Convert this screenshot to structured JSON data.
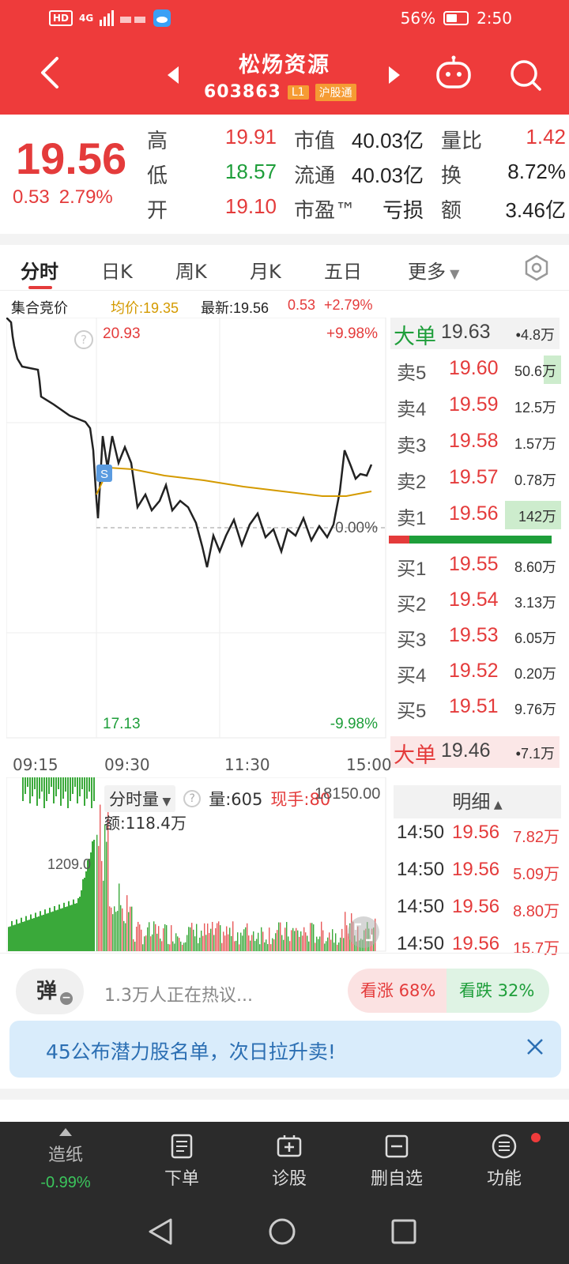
{
  "status_bar": {
    "network": "HD",
    "signal": "4G",
    "battery_pct": "56%",
    "time": "2:50"
  },
  "header": {
    "stock_name": "松炀资源",
    "stock_code": "603863",
    "tag_level": "L1",
    "tag_connect": "沪股通"
  },
  "quote": {
    "price": "19.56",
    "change": "0.53",
    "change_pct": "2.79%",
    "high_label": "高",
    "high": "19.91",
    "low_label": "低",
    "low": "18.57",
    "open_label": "开",
    "open": "19.10",
    "mcap_label": "市值",
    "mcap": "40.03亿",
    "float_label": "流通",
    "float": "40.03亿",
    "pe_label": "市盈™",
    "pe": "亏损",
    "vr_label": "量比",
    "vr": "1.42",
    "turn_label": "换",
    "turn": "8.72%",
    "amt_label": "额",
    "amt": "3.46亿"
  },
  "tabs": [
    "分时",
    "日K",
    "周K",
    "月K",
    "五日",
    "更多"
  ],
  "info_row": {
    "auction": "集合竞价",
    "avg": "均价:19.35",
    "latest": "最新:19.56",
    "chg": "0.53",
    "pct": "+2.79%"
  },
  "chart_labels": {
    "top_price": "20.93",
    "top_pct": "+9.98%",
    "bottom_price": "17.13",
    "bottom_pct": "-9.98%",
    "zero_pct": "0.00%",
    "s_marker": "S"
  },
  "time_axis": [
    "09:15",
    "09:30",
    "11:30",
    "15:00"
  ],
  "order_book": {
    "big_top": {
      "label": "大单",
      "price": "19.63",
      "vol": "•4.8万"
    },
    "asks": [
      {
        "label": "卖5",
        "price": "19.60",
        "vol": "50.6万",
        "fill": 0.1
      },
      {
        "label": "卖4",
        "price": "19.59",
        "vol": "12.5万",
        "fill": 0
      },
      {
        "label": "卖3",
        "price": "19.58",
        "vol": "1.57万",
        "fill": 0
      },
      {
        "label": "卖2",
        "price": "19.57",
        "vol": "0.78万",
        "fill": 0
      },
      {
        "label": "卖1",
        "price": "19.56",
        "vol": "142万",
        "fill": 0.32
      }
    ],
    "bids": [
      {
        "label": "买1",
        "price": "19.55",
        "vol": "8.60万"
      },
      {
        "label": "买2",
        "price": "19.54",
        "vol": "3.13万"
      },
      {
        "label": "买3",
        "price": "19.53",
        "vol": "6.05万"
      },
      {
        "label": "买4",
        "price": "19.52",
        "vol": "0.20万"
      },
      {
        "label": "买5",
        "price": "19.51",
        "vol": "9.76万"
      }
    ],
    "big_bottom": {
      "label": "大单",
      "price": "19.46",
      "vol": "•7.1万"
    }
  },
  "volume": {
    "title": "分时量",
    "vol": "量:605",
    "hand": "现手:80",
    "max": "18150.00",
    "amount": "额:118.4万",
    "mid": "1209.0"
  },
  "detail": {
    "title": "明细",
    "rows": [
      {
        "time": "14:50",
        "price": "19.56",
        "vol": "7.82万"
      },
      {
        "time": "14:50",
        "price": "19.56",
        "vol": "5.09万"
      },
      {
        "time": "14:50",
        "price": "19.56",
        "vol": "8.80万"
      },
      {
        "time": "14:50",
        "price": "19.56",
        "vol": "15.7万"
      }
    ]
  },
  "comment": {
    "dan": "弹",
    "discuss": "1.3万人正在热议...",
    "bull": "看涨 68%",
    "bear": "看跌 32%"
  },
  "banner": {
    "text": "45公布潜力股名单，次日拉升卖!"
  },
  "toolbar": {
    "zz_name": "造纸",
    "zz_change": "-0.99%",
    "order": "下单",
    "diag": "诊股",
    "remove": "删自选",
    "func": "功能"
  },
  "colors": {
    "up": "#e43b3b",
    "down": "#1e9e3a",
    "avg": "#d49a00",
    "header": "#ee3b3b"
  }
}
